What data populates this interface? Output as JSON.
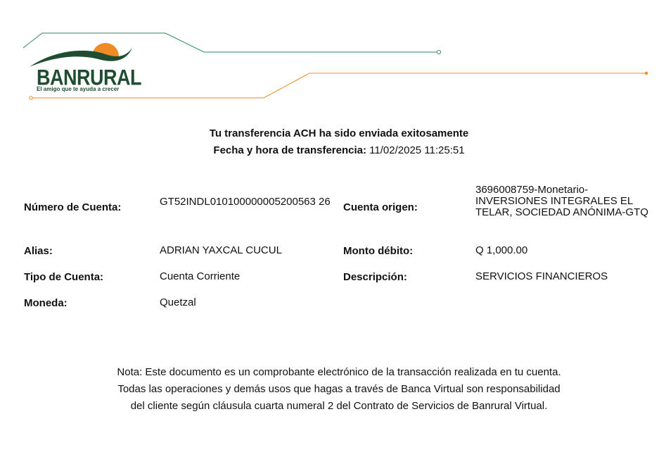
{
  "brand": {
    "name": "BANRURAL",
    "tagline": "El amigo que te ayuda a crecer",
    "colors": {
      "green": "#1f4d32",
      "line_green": "#2e8b57",
      "orange": "#f08a24"
    }
  },
  "receipt": {
    "title": "Tu transferencia ACH ha sido enviada exitosamente",
    "datetime_label": "Fecha y hora de transferencia:",
    "datetime_value": "11/02/2025 11:25:51"
  },
  "details": {
    "numero_cuenta": {
      "label": "Número de Cuenta:",
      "value": "GT52INDL010100000005200563 26"
    },
    "alias": {
      "label": "Alias:",
      "value": "ADRIAN YAXCAL CUCUL"
    },
    "tipo_cuenta": {
      "label": "Tipo de Cuenta:",
      "value": "Cuenta Corriente"
    },
    "moneda": {
      "label": "Moneda:",
      "value": "Quetzal"
    },
    "cuenta_origen": {
      "label": "Cuenta origen:",
      "value": "3696008759-Monetario-INVERSIONES INTEGRALES EL TELAR, SOCIEDAD ANÓNIMA-GTQ"
    },
    "monto_debito": {
      "label": "Monto débito:",
      "value": "Q 1,000.00"
    },
    "descripcion": {
      "label": "Descripción:",
      "value": "SERVICIOS FINANCIEROS"
    }
  },
  "note": {
    "line1": "Nota: Este documento es un comprobante electrónico de la transacción realizada en tu cuenta.",
    "line2": "Todas las operaciones y demás usos que hagas a través de Banca Virtual son responsabilidad",
    "line3": "del cliente según cláusula cuarta numeral 2 del Contrato de Servicios de Banrural Virtual."
  }
}
